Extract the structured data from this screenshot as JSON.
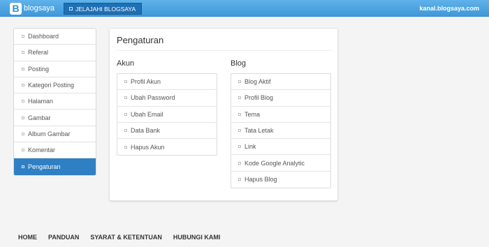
{
  "header": {
    "logo_letter": "B",
    "logo_text": "blogsaya",
    "explore_label": "JELAJAHI BLOGSAYA",
    "domain": "kanal.blogsaya.com"
  },
  "sidebar": {
    "items": [
      {
        "label": "Dashboard"
      },
      {
        "label": "Referal"
      },
      {
        "label": "Posting"
      },
      {
        "label": "Kategori Posting"
      },
      {
        "label": "Halaman"
      },
      {
        "label": "Gambar"
      },
      {
        "label": "Album Gambar"
      },
      {
        "label": "Komentar"
      },
      {
        "label": "Pengaturan",
        "active": true
      }
    ]
  },
  "main": {
    "title": "Pengaturan",
    "akun": {
      "heading": "Akun",
      "items": [
        "Profil Akun",
        "Ubah Password",
        "Ubah Email",
        "Data Bank",
        "Hapus Akun"
      ]
    },
    "blog": {
      "heading": "Blog",
      "items": [
        "Blog Aktif",
        "Profil Blog",
        "Tema",
        "Tata Letak",
        "Link",
        "Kode Google Analytic",
        "Hapus Blog"
      ]
    }
  },
  "footer": {
    "links": [
      "HOME",
      "PANDUAN",
      "SYARAT & KETENTUAN",
      "HUBUNGI KAMI"
    ]
  },
  "colors": {
    "topbar": "#4aa3e0",
    "active_item": "#2f7fc4",
    "explore_button": "#1f6fb3"
  }
}
